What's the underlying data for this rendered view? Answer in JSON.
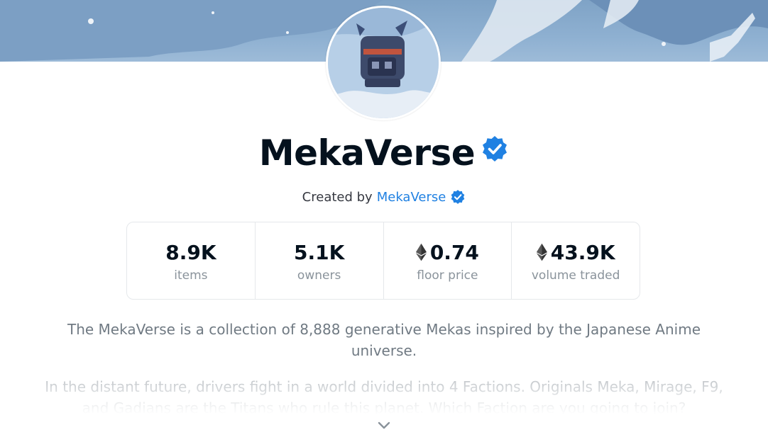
{
  "collection": {
    "name": "MekaVerse",
    "verified_icon": "verified-badge-icon",
    "creator_prefix": "Created by",
    "creator_name": "MekaVerse"
  },
  "stats": [
    {
      "value": "8.9K",
      "label": "items",
      "currency_icon": ""
    },
    {
      "value": "5.1K",
      "label": "owners",
      "currency_icon": ""
    },
    {
      "value": "0.74",
      "label": "floor price",
      "currency_icon": "ethereum-icon"
    },
    {
      "value": "43.9K",
      "label": "volume traded",
      "currency_icon": "ethereum-icon"
    }
  ],
  "description": {
    "paragraph1": "The MekaVerse is a collection of 8,888 generative Mekas inspired by the Japanese Anime universe.",
    "paragraph2": "In the distant future, drivers fight in a world divided into 4 Factions. Originals Meka, Mirage, F9, and Gadians are the Titans who rule this planet. Which Faction are you going to join?"
  },
  "expand_icon": "chevron-down-icon",
  "colors": {
    "accent": "#2081e2",
    "title": "#04111d",
    "muted": "#8a939b",
    "border": "#e5e8eb"
  }
}
